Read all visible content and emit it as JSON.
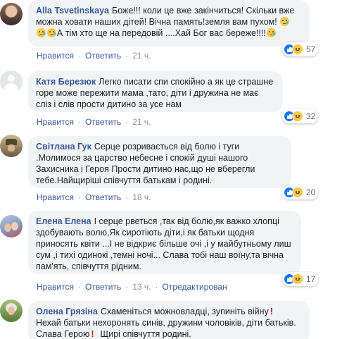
{
  "comments": [
    {
      "author": "Alla Tsvetinskaya",
      "text_1": "Боже!!! коли це вже закінчиться! Скільки вже можна ховати наших дітей! Вічна память!земля вам пухом! ",
      "text_2": "А тім хто ще на передовій ....Хай Бог вас береже!!!!",
      "like_label": "Нравится",
      "reply_label": "Ответить",
      "time": "21 ч.",
      "reaction_count": "57",
      "reaction_icons": [
        "like-icon",
        "sad-icon"
      ]
    },
    {
      "author": "Катя Березюк",
      "text": "Легко писати спи спокійно а як це страшне горе може пережити мама ,тато, діти і дружина не має сліз і слів прости дитино за усе нам",
      "like_label": "Нравится",
      "reply_label": "Ответить",
      "time": "21 ч.",
      "reaction_count": "32",
      "reaction_icons": [
        "like-icon",
        "sad-icon"
      ]
    },
    {
      "author": "Світлана Гук",
      "text": "Серце розривається від болю і туги .Молимося за царство небесне і спокій душі нашого Захисника і Героя Прости дитино нас,що не вберегли тебе.Найщиріші співчуття батькам і родині.",
      "like_label": "Нравится",
      "reply_label": "Ответить",
      "time": "18 ч.",
      "reaction_count": "20",
      "reaction_icons": [
        "like-icon",
        "sad-icon"
      ]
    },
    {
      "author": "Елена Елена",
      "text": "І серце рветься ,так від болю,як важко хлопці здобувають волю,Як сиротіють діти,і як батьки щодня приносять квіти ...І не відкриє більше очі ,і у майбутньому лиш сум ,і тихі одинокі ,темні ночі... Слава тобі наш воїну,та вічна пам'ять, співчуття рідним.",
      "like_label": "Нравится",
      "reply_label": "Ответить",
      "time": "13 ч.",
      "edited_label": "Отредактирован",
      "reaction_count": "17",
      "reaction_icons": [
        "like-icon",
        "sad-icon"
      ]
    },
    {
      "author": "Олена Грязіна",
      "text_1": "Схаменіться можновладці, зупиніть війну",
      "text_2": " Нехай батьки нехоронять синів, дружини чоловіків, діти батьків. Слава Герою",
      "text_3": "  Щирі співчуття родині."
    }
  ],
  "colors": {
    "link": "#385898",
    "bubble": "#f2f3f5",
    "meta": "#606770",
    "like": "#1877f2",
    "sad": "#f7c84a"
  }
}
